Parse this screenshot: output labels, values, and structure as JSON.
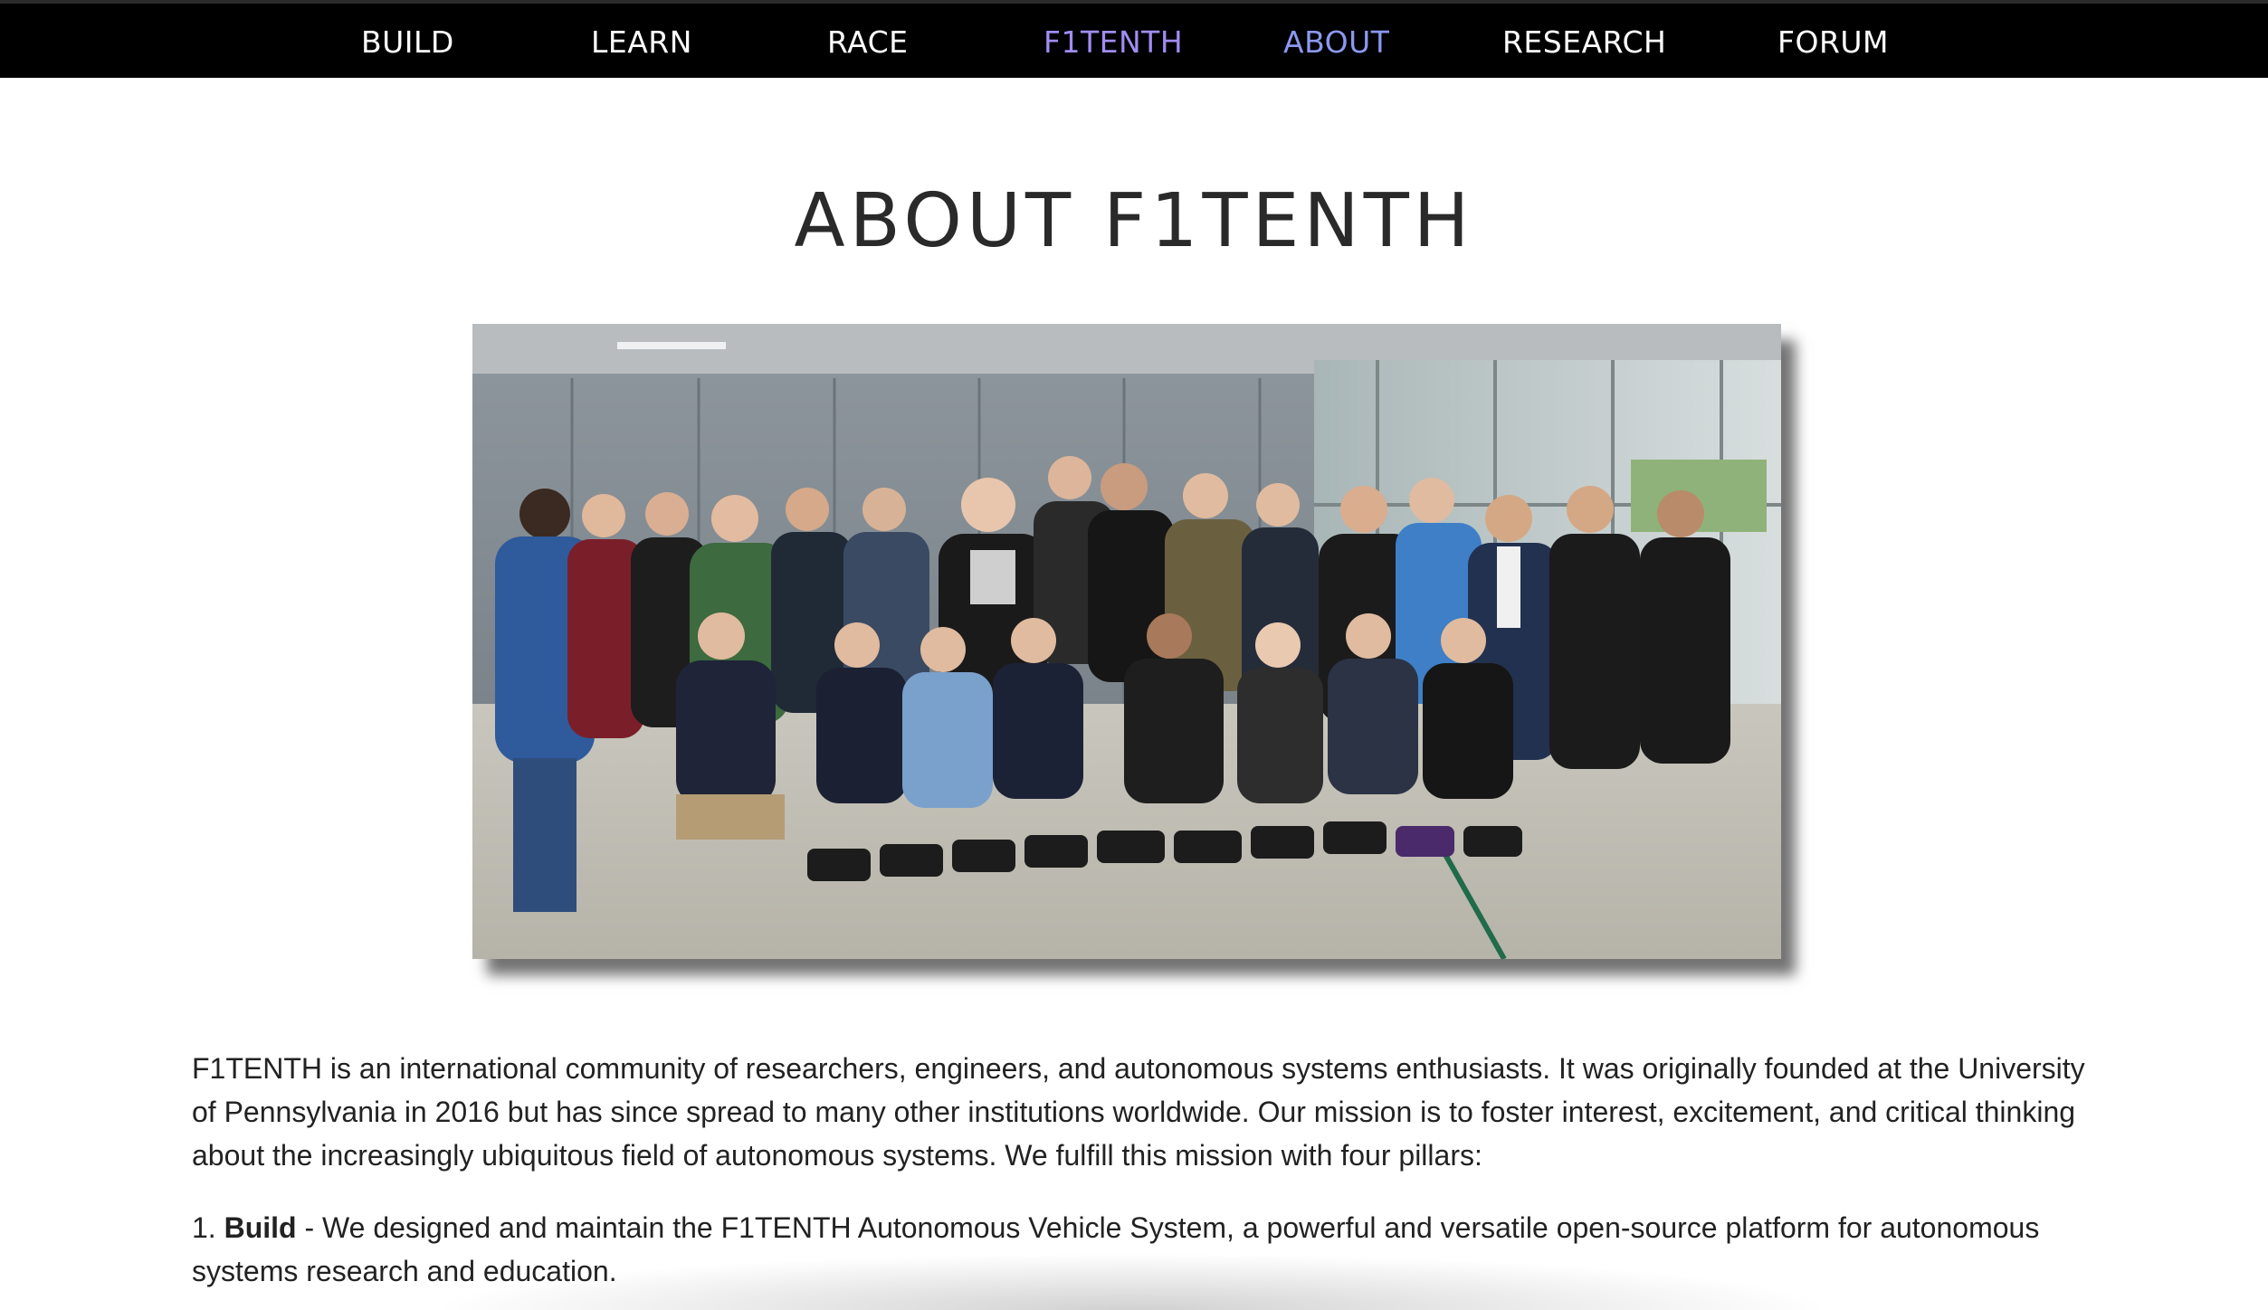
{
  "nav": {
    "items": [
      {
        "label": "BUILD"
      },
      {
        "label": "LEARN"
      },
      {
        "label": "RACE"
      },
      {
        "label": "F1TENTH"
      },
      {
        "label": "ABOUT"
      },
      {
        "label": "RESEARCH"
      },
      {
        "label": "FORUM"
      }
    ],
    "colors": {
      "default": "#ffffff",
      "f1tenth": "#a18cf2",
      "current": "#8c98ef"
    }
  },
  "page": {
    "title": "ABOUT F1TENTH",
    "intro": "F1TENTH is an international community of researchers, engineers, and autonomous systems enthusiasts. It was originally founded at the University of Pennsylvania in 2016 but has since spread to many other institutions worldwide. Our mission is to foster interest, excitement, and critical thinking about the increasingly ubiquitous field of autonomous systems. We fulfill this mission with four pillars:",
    "pillar1": {
      "number": "1.",
      "name": "Build",
      "text": " - We designed and maintain the F1TENTH Autonomous Vehicle System, a powerful and versatile open-source platform for autonomous systems research and education."
    }
  },
  "photo": {
    "subject": "group-photo-icon"
  }
}
